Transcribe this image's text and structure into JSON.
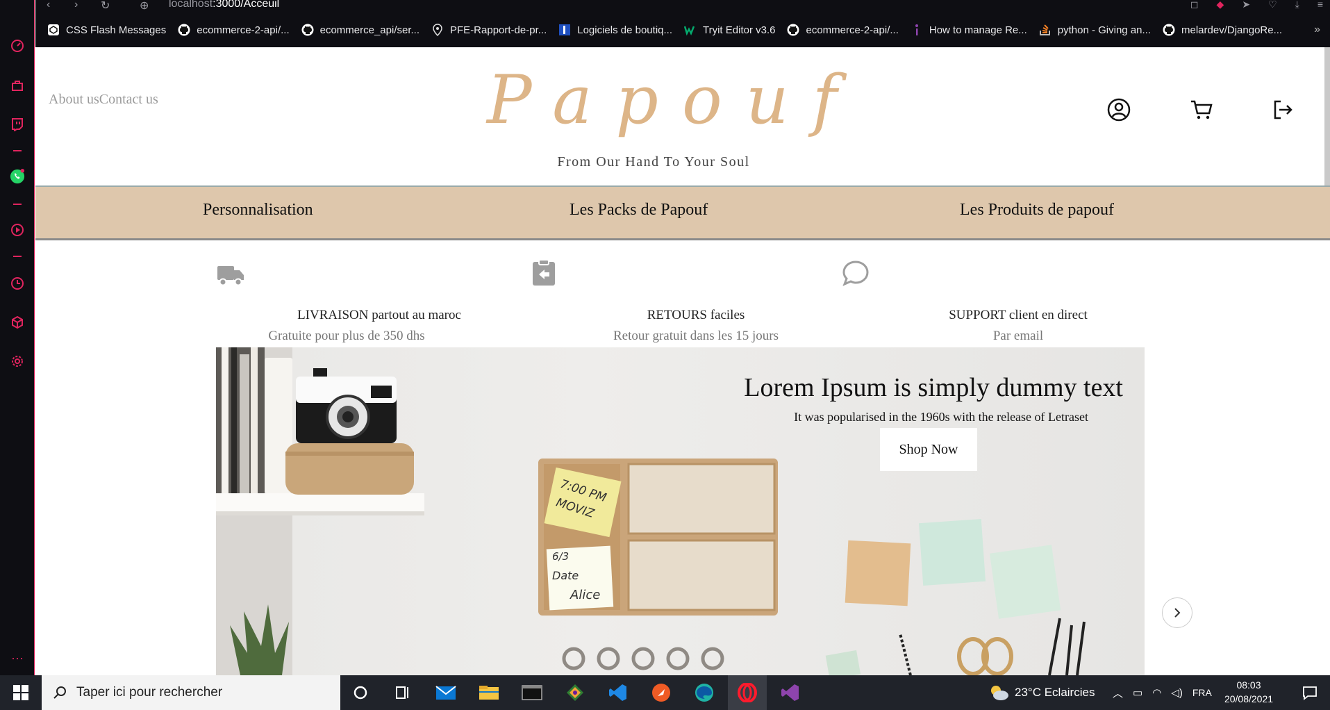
{
  "browser": {
    "url_host": "localhost",
    "url_path": ":3000/Acceuil",
    "bookmarks": [
      {
        "label": "CSS Flash Messages",
        "icon": "codepen-icon"
      },
      {
        "label": "ecommerce-2-api/...",
        "icon": "github-icon"
      },
      {
        "label": "ecommerce_api/ser...",
        "icon": "github-icon"
      },
      {
        "label": "PFE-Rapport-de-pr...",
        "icon": "location-pin-icon"
      },
      {
        "label": "Logiciels de boutiq...",
        "icon": "bookmark-blue-icon"
      },
      {
        "label": "Tryit Editor v3.6",
        "icon": "w3schools-icon"
      },
      {
        "label": "ecommerce-2-api/...",
        "icon": "github-icon"
      },
      {
        "label": "How to manage Re...",
        "icon": "dev-icon"
      },
      {
        "label": "python - Giving an...",
        "icon": "stackoverflow-icon"
      },
      {
        "label": "melardev/DjangoRe...",
        "icon": "github-icon"
      }
    ],
    "more_label": "»"
  },
  "header": {
    "links": "About usContact us",
    "logo": "Papouf",
    "tagline": "From Our Hand To Your Soul"
  },
  "menu": {
    "items": [
      "Personnalisation",
      "Les Packs de Papouf",
      "Les Produits de papouf"
    ]
  },
  "features": [
    {
      "title": "LIVRAISON partout au maroc",
      "subtitle": "Gratuite pour plus de 350 dhs",
      "icon": "truck-icon"
    },
    {
      "title": "RETOURS faciles",
      "subtitle": "Retour gratuit dans les 15 jours",
      "icon": "return-icon"
    },
    {
      "title": "SUPPORT client en direct",
      "subtitle": "Par email",
      "icon": "chat-bubble-icon"
    }
  ],
  "banner": {
    "title": "Lorem Ipsum is simply dummy text",
    "subtitle": "It was popularised in the 1960s with the release of Letraset",
    "cta": "Shop Now",
    "note1": "7:00 PM",
    "note1b": "MOVIZ",
    "note2": "6/3",
    "note2b": "Date",
    "note2c": "Alice"
  },
  "taskbar": {
    "search_placeholder": "Taper ici pour rechercher",
    "weather": "23°C  Eclaircies",
    "language": "FRA",
    "time": "08:03",
    "date": "20/08/2021"
  },
  "colors": {
    "logo": "#ddb588",
    "menu_bg": "#dec7ac",
    "opera_accent": "#e0245e",
    "browser_bg": "#0e0e13",
    "taskbar_bg": "#20232a"
  }
}
